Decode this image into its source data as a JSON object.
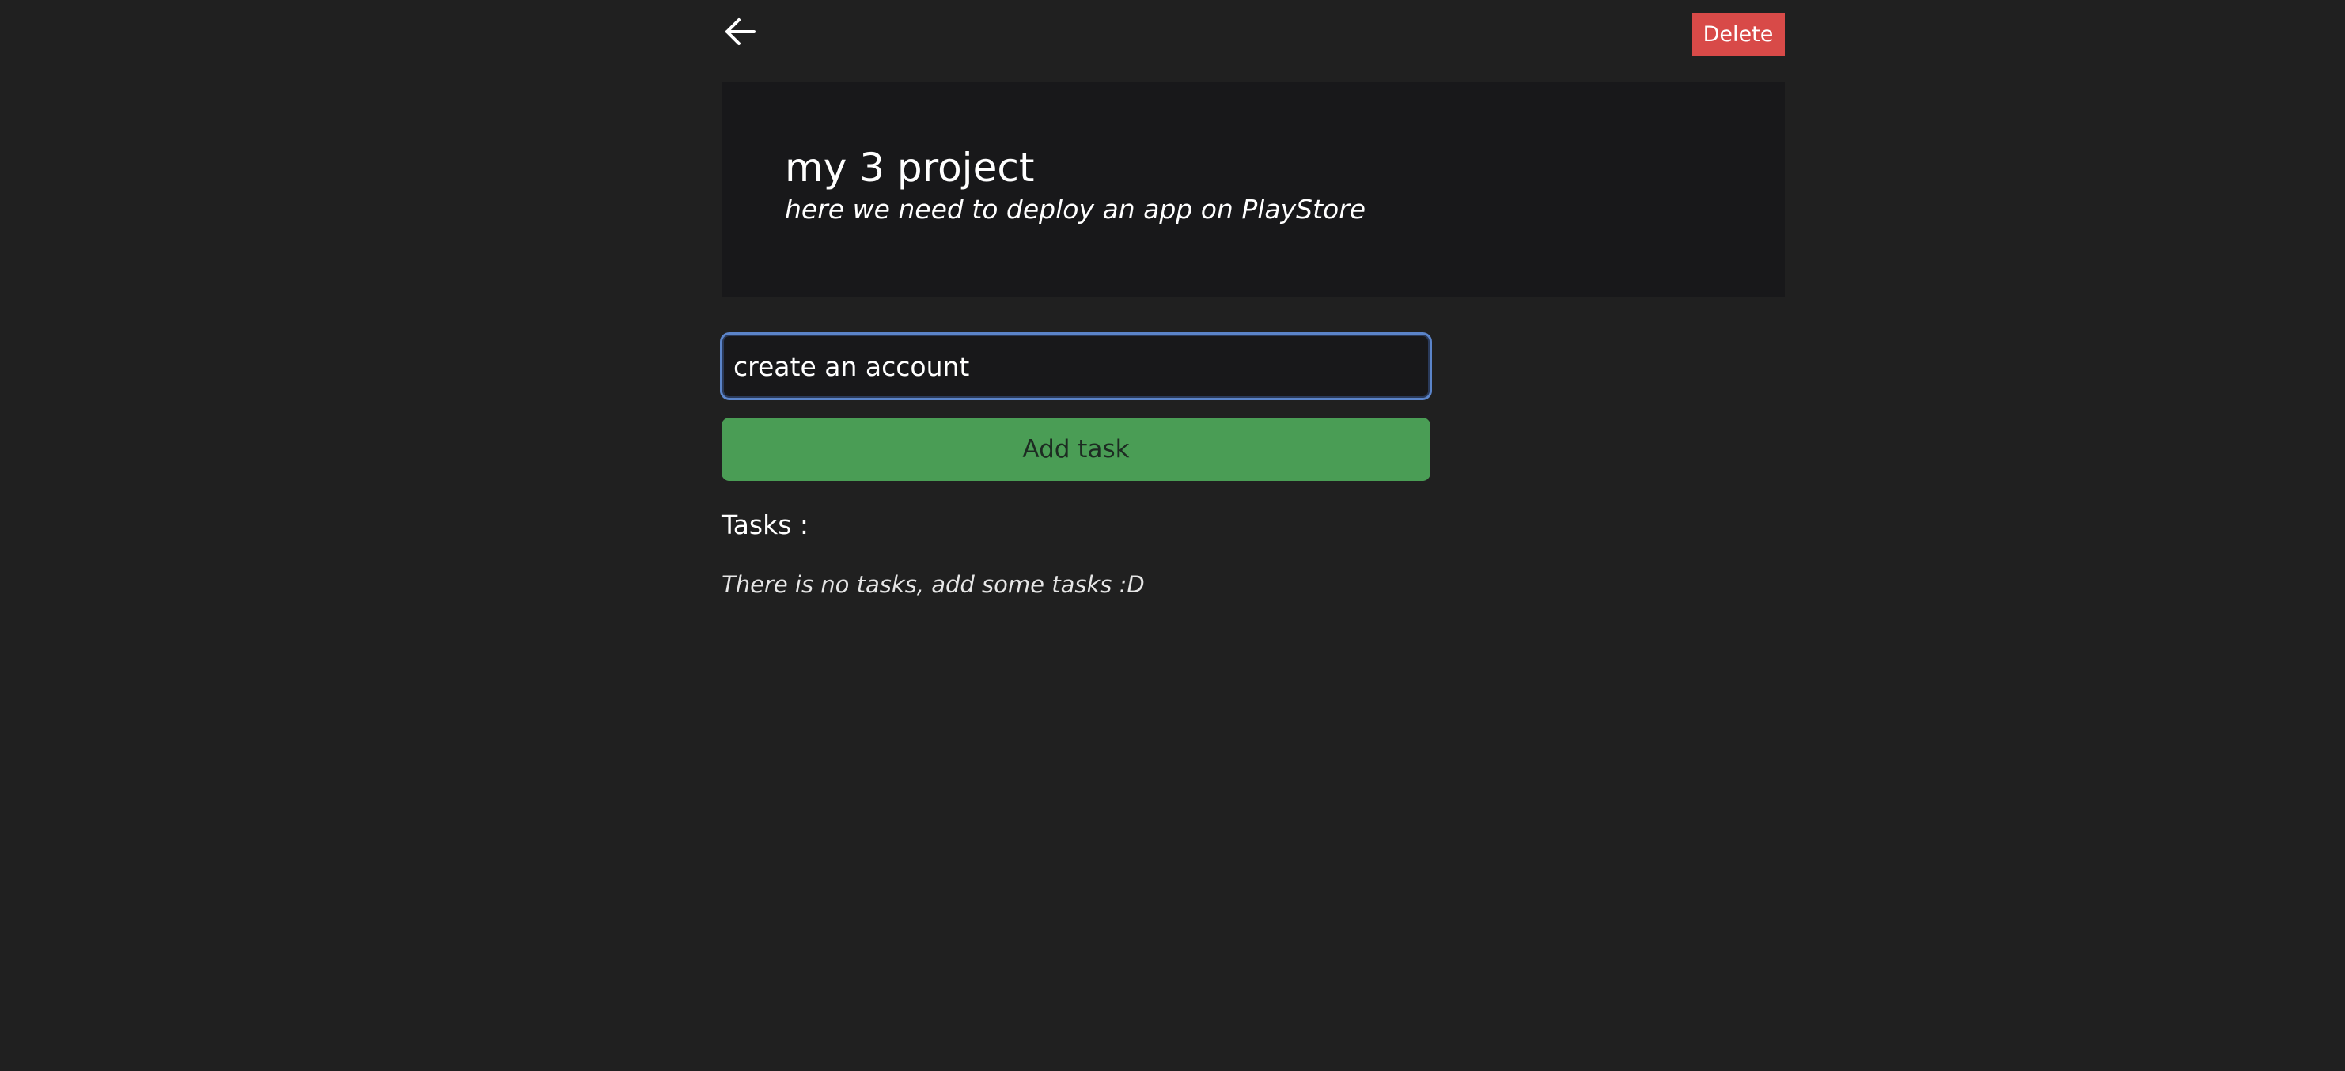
{
  "header": {
    "back_icon": "arrow-left-icon",
    "delete_label": "Delete",
    "delete_color": "#d84a48"
  },
  "project": {
    "title": "my 3 project",
    "description": "here we need to deploy an app on PlayStore"
  },
  "task_form": {
    "input_value": "create an account ",
    "add_label": "Add task",
    "add_color": "#4a9d55"
  },
  "tasks": {
    "heading": "Tasks :",
    "empty_message": "There is no tasks, add some tasks :D",
    "items": []
  }
}
